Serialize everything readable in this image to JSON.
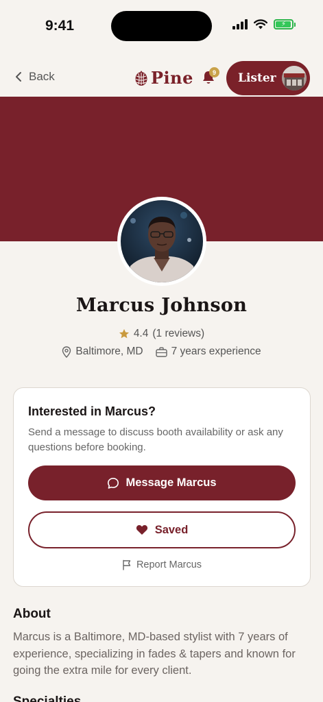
{
  "status_bar": {
    "time": "9:41"
  },
  "nav": {
    "back_label": "Back",
    "brand_name": "Pine",
    "notification_count": "9",
    "lister_label": "Lister"
  },
  "profile": {
    "name": "Marcus Johnson",
    "rating": "4.4",
    "reviews": "(1 reviews)",
    "location": "Baltimore, MD",
    "experience": "7 years experience"
  },
  "card": {
    "title": "Interested in Marcus?",
    "description": "Send a message to discuss booth availability or ask any questions before booking.",
    "message_button": "Message Marcus",
    "saved_button": "Saved",
    "report_link": "Report Marcus"
  },
  "about": {
    "title": "About",
    "text": "Marcus is a Baltimore, MD-based stylist with 7 years of experience, specializing in fades & tapers and known for going the extra mile for every client."
  },
  "specialties": {
    "title": "Specialties"
  },
  "colors": {
    "brand": "#78212b",
    "accent_gold": "#c9a24a",
    "background": "#f6f3ef"
  }
}
